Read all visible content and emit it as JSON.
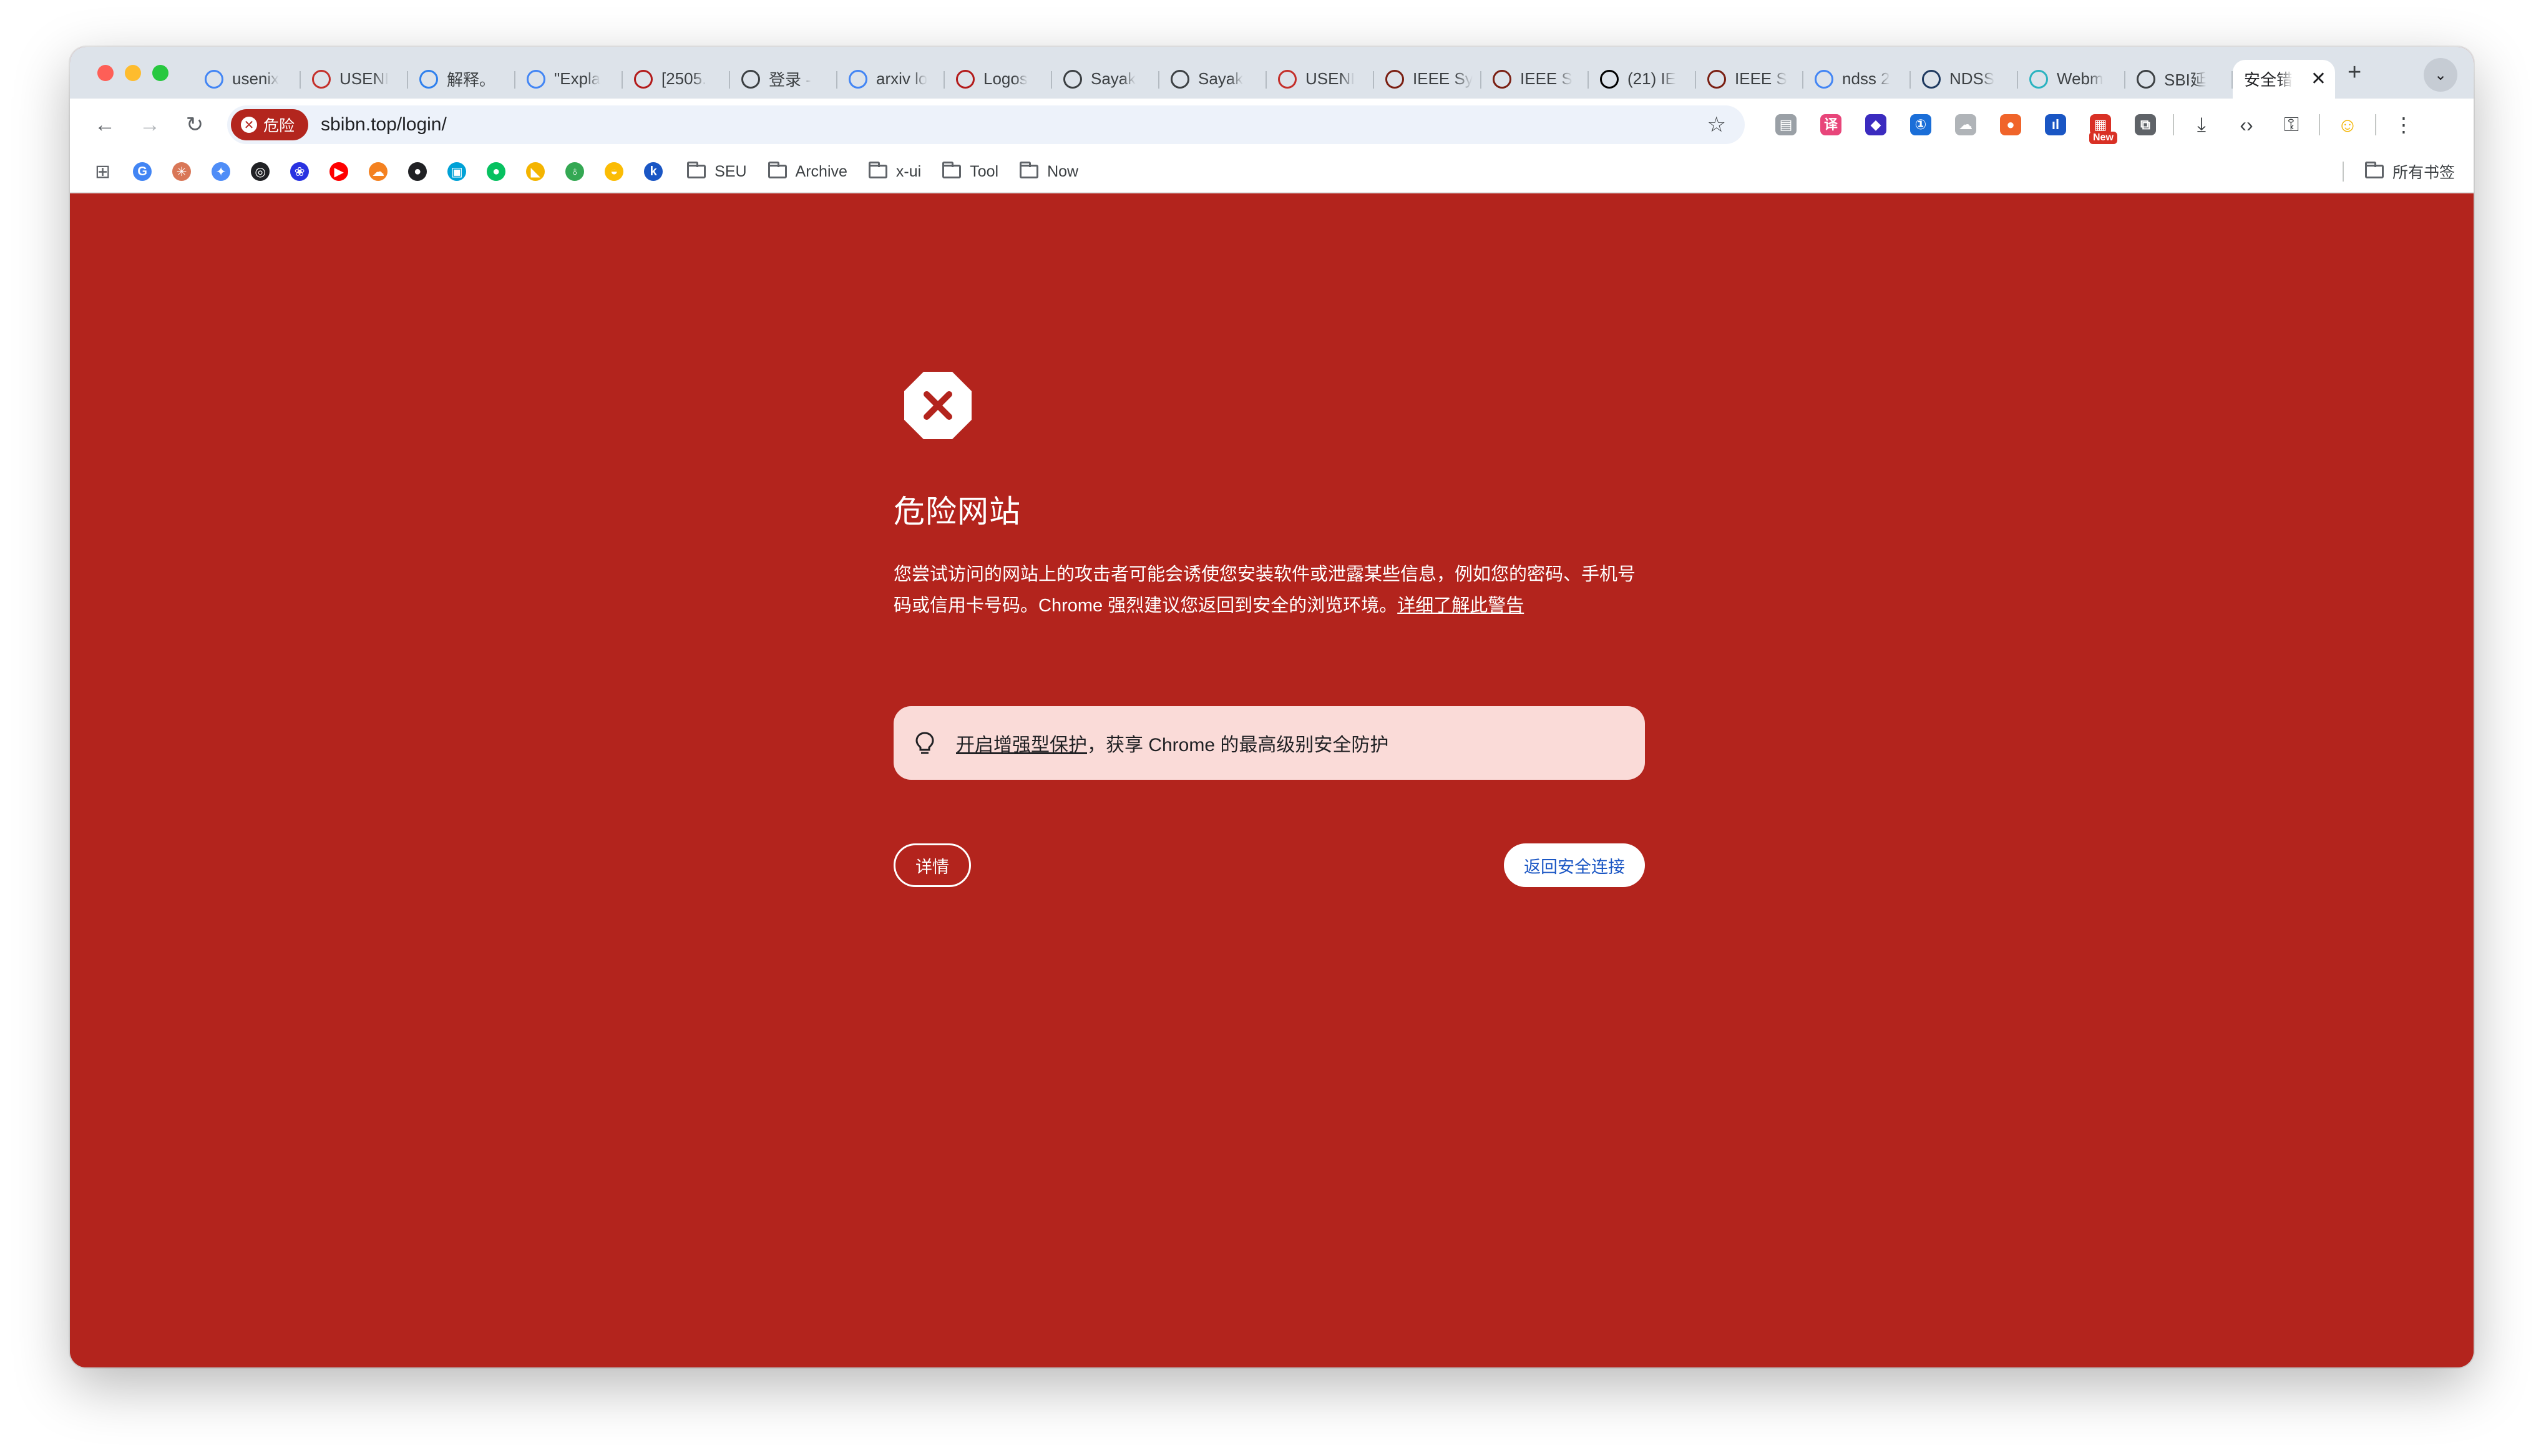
{
  "tabs": [
    {
      "label": "usenix",
      "icon": "google-icon",
      "color": "#4285f4"
    },
    {
      "label": "USENI",
      "icon": "usenix-icon",
      "color": "#c4302b"
    },
    {
      "label": "解释。",
      "icon": "chatbot-icon",
      "color": "#2f80ed"
    },
    {
      "label": "\"Expla",
      "icon": "google-icon",
      "color": "#4285f4"
    },
    {
      "label": "[2505.",
      "icon": "arxiv-icon",
      "color": "#b31b1b"
    },
    {
      "label": "登录 - ",
      "icon": "at-icon",
      "color": "#3c4043"
    },
    {
      "label": "arxiv lo",
      "icon": "google-icon",
      "color": "#4285f4"
    },
    {
      "label": "Logos",
      "icon": "arxiv-icon",
      "color": "#b31b1b"
    },
    {
      "label": "Sayak",
      "icon": "globe-icon",
      "color": "#3c4043"
    },
    {
      "label": "Sayak",
      "icon": "globe-icon",
      "color": "#3c4043"
    },
    {
      "label": "USENI",
      "icon": "usenix-icon",
      "color": "#c4302b"
    },
    {
      "label": "IEEE Sy",
      "icon": "ieee-sp-icon",
      "color": "#7a1f12"
    },
    {
      "label": "IEEE S",
      "icon": "ieee-sp-icon",
      "color": "#7a1f12"
    },
    {
      "label": "(21) IE",
      "icon": "x-icon",
      "color": "#000000"
    },
    {
      "label": "IEEE S",
      "icon": "ieee-sp-icon",
      "color": "#7a1f12"
    },
    {
      "label": "ndss 2",
      "icon": "google-icon",
      "color": "#4285f4"
    },
    {
      "label": "NDSS",
      "icon": "ndss-icon",
      "color": "#1f3a60"
    },
    {
      "label": "Webm",
      "icon": "cube-icon",
      "color": "#2bb3c0"
    },
    {
      "label": "SBI延",
      "icon": "globe-icon",
      "color": "#3c4043"
    }
  ],
  "active_tab": {
    "label": "安全错",
    "close": "✕"
  },
  "new_tab": "+",
  "tab_menu": "⌄",
  "nav": {
    "back": "←",
    "forward": "→",
    "reload": "↻"
  },
  "omnibox": {
    "chip_label": "危险",
    "chip_icon": "✕",
    "url": "sbibn.top/login/",
    "star": "☆"
  },
  "extensions": [
    {
      "name": "reader-icon",
      "glyph": "▤",
      "color": "#9aa0a6"
    },
    {
      "name": "translate-icon",
      "glyph": "译",
      "color": "#e8457a"
    },
    {
      "name": "layers-icon",
      "glyph": "◆",
      "color": "#3b2bbf"
    },
    {
      "name": "password-icon",
      "glyph": "①",
      "color": "#1a6ed8"
    },
    {
      "name": "cloud-icon",
      "glyph": "☁",
      "color": "#b0b4b8"
    },
    {
      "name": "fox-icon",
      "glyph": "●",
      "color": "#f0642a"
    },
    {
      "name": "stats-icon",
      "glyph": "ıl",
      "color": "#1a56c4"
    },
    {
      "name": "calendar-new-icon",
      "glyph": "▦",
      "color": "#d93025",
      "badge": "New"
    },
    {
      "name": "puzzle-icon",
      "glyph": "⧉",
      "color": "#5f6368"
    }
  ],
  "toolbar_tools": [
    {
      "name": "download-icon",
      "glyph": "⤓"
    },
    {
      "name": "code-icon",
      "glyph": "‹›"
    },
    {
      "name": "key-icon",
      "glyph": "⚿"
    }
  ],
  "profile_glyph": "☺",
  "menu_glyph": "⋮",
  "bookmarks": {
    "apps_glyph": "⊞",
    "icons": [
      {
        "name": "google-bookmark-icon",
        "glyph": "G",
        "color": "#4285f4"
      },
      {
        "name": "claude-bookmark-icon",
        "glyph": "✳",
        "color": "#d97757"
      },
      {
        "name": "gemini-bookmark-icon",
        "glyph": "✦",
        "color": "#4f8df7"
      },
      {
        "name": "openai-bookmark-icon",
        "glyph": "◎",
        "color": "#202124"
      },
      {
        "name": "baidu-bookmark-icon",
        "glyph": "❀",
        "color": "#2932e1"
      },
      {
        "name": "youtube-bookmark-icon",
        "glyph": "▶",
        "color": "#ff0000"
      },
      {
        "name": "cloudflare-bookmark-icon",
        "glyph": "☁",
        "color": "#f48120"
      },
      {
        "name": "github-bookmark-icon",
        "glyph": "●",
        "color": "#202124"
      },
      {
        "name": "bilibili-bookmark-icon",
        "glyph": "▣",
        "color": "#00a1d6"
      },
      {
        "name": "wechat-bookmark-icon",
        "glyph": "●",
        "color": "#07c160"
      },
      {
        "name": "bookmark-flag-icon",
        "glyph": "◣",
        "color": "#f4b400"
      },
      {
        "name": "leaf-bookmark-icon",
        "glyph": "♁",
        "color": "#34a853"
      },
      {
        "name": "stripe-bookmark-icon",
        "glyph": "◒",
        "color": "#fbbc04"
      },
      {
        "name": "blue-k-bookmark-icon",
        "glyph": "k",
        "color": "#1a56c4"
      }
    ],
    "folders": [
      "SEU",
      "Archive",
      "x-ui",
      "Tool",
      "Now"
    ],
    "all_bookmarks": "所有书签"
  },
  "warning": {
    "heading": "危险网站",
    "body": "您尝试访问的网站上的攻击者可能会诱使您安装软件或泄露某些信息，例如您的密码、手机号码或信用卡号码。Chrome 强烈建议您返回到安全的浏览环境。",
    "learn_more": "详细了解此警告",
    "tip_link": "开启增强型保护",
    "tip_text": "，获享 Chrome 的最高级别安全防护",
    "details_button": "详情",
    "back_button": "返回安全连接",
    "bg_color": "#b3241d",
    "tip_bg": "#fadbd8"
  }
}
